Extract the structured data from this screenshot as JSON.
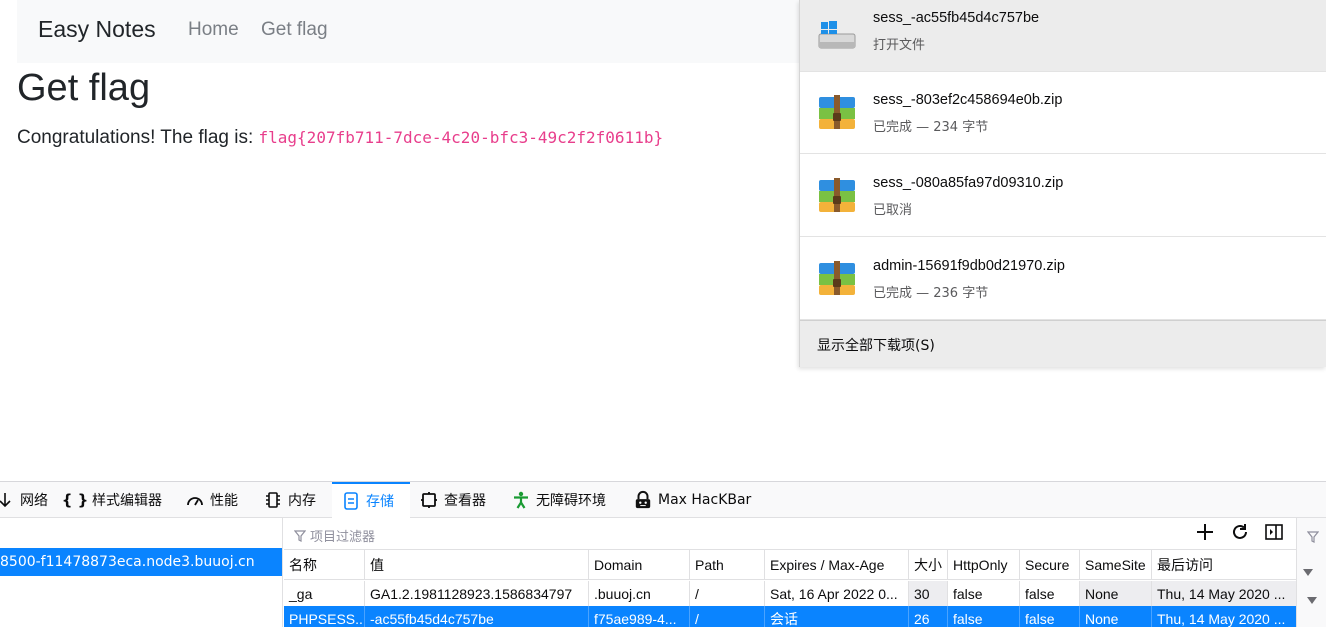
{
  "page": {
    "brand": "Easy Notes",
    "nav": [
      "Home",
      "Get flag"
    ],
    "title": "Get flag",
    "message": "Congratulations! The flag is:",
    "flag": "flag{207fb711-7dce-4c20-bfc3-49c2f2f0611b}"
  },
  "downloads": {
    "items": [
      {
        "name": "sess_-ac55fb45d4c757be",
        "status": "打开文件",
        "icon": "drive-icon"
      },
      {
        "name": "sess_-803ef2c458694e0b.zip",
        "status": "已完成 — 234 字节",
        "icon": "zip-archive-icon"
      },
      {
        "name": "sess_-080a85fa97d09310.zip",
        "status": "已取消",
        "icon": "zip-archive-icon"
      },
      {
        "name": "admin-15691f9db0d21970.zip",
        "status": "已完成 — 236 字节",
        "icon": "zip-archive-icon"
      }
    ],
    "show_all": "显示全部下载项(S)"
  },
  "devtools": {
    "tabs": [
      {
        "label": "网络",
        "icon": "network-icon"
      },
      {
        "label": "样式编辑器",
        "icon": "braces-icon"
      },
      {
        "label": "性能",
        "icon": "gauge-icon"
      },
      {
        "label": "内存",
        "icon": "memory-icon"
      },
      {
        "label": "存储",
        "icon": "storage-icon"
      },
      {
        "label": "查看器",
        "icon": "accessibility-icon"
      },
      {
        "label": "无障碍环境",
        "icon": "person-icon"
      },
      {
        "label": "Max HacKBar",
        "icon": "hackbar-icon"
      }
    ],
    "selected_tab": "存储",
    "tree_item": "8500-f11478873eca.node3.buuoj.cn",
    "filter_placeholder": "项目过滤器",
    "columns": [
      "名称",
      "值",
      "Domain",
      "Path",
      "Expires / Max-Age",
      "大小",
      "HttpOnly",
      "Secure",
      "SameSite",
      "最后访问"
    ],
    "rows": [
      [
        "_ga",
        "GA1.2.1981128923.1586834797",
        ".buuoj.cn",
        "/",
        "Sat, 16 Apr 2022 0...",
        "30",
        "false",
        "false",
        "None",
        "Thu, 14 May 2020 ..."
      ],
      [
        "PHPSESS...",
        "-ac55fb45d4c757be",
        "f75ae989-4...",
        "/",
        "会话",
        "26",
        "false",
        "false",
        "None",
        "Thu, 14 May 2020 ..."
      ]
    ],
    "accent": "#0a84ff"
  }
}
